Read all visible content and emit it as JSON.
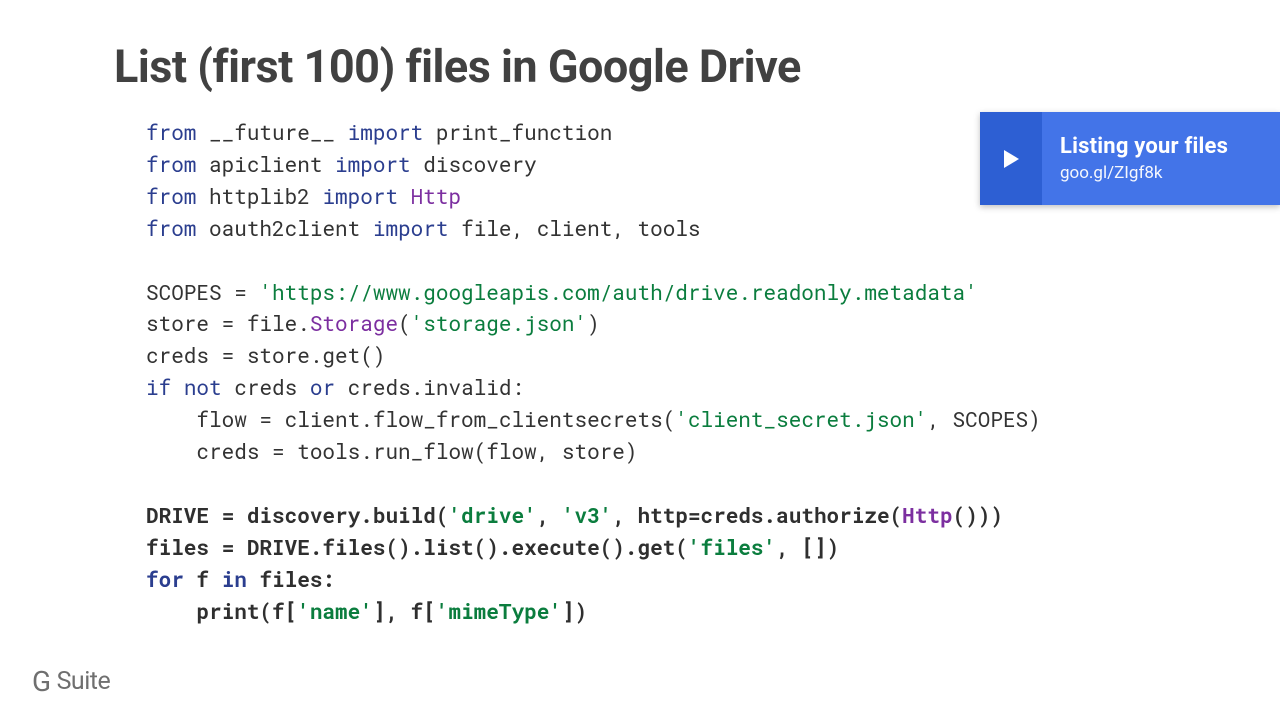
{
  "slide": {
    "title": "List (first 100) files in Google Drive"
  },
  "callout": {
    "title": "Listing your files",
    "link": "goo.gl/ZIgf8k"
  },
  "logo": {
    "g": "G",
    "suite": "Suite"
  },
  "code": {
    "l1": {
      "from": "from",
      "pkg": " __future__ ",
      "import": "import",
      "rest": " print_function"
    },
    "l2": {
      "from": "from",
      "pkg": " apiclient ",
      "import": "import",
      "rest": " discovery"
    },
    "l3": {
      "from": "from",
      "pkg": " httplib2 ",
      "import": "import",
      "cls": " Http"
    },
    "l4": {
      "from": "from",
      "pkg": " oauth2client ",
      "import": "import",
      "rest": " file, client, tools"
    },
    "l6": {
      "a": "SCOPES = ",
      "s": "'https://www.googleapis.com/auth/drive.readonly.metadata'"
    },
    "l7": {
      "a": "store = file.",
      "b": "Storage",
      "c": "(",
      "s": "'storage.json'",
      "d": ")"
    },
    "l8": {
      "a": "creds = store.get()"
    },
    "l9": {
      "if": "if",
      "sp1": " ",
      "not": "not",
      "mid": " creds ",
      "or": "or",
      "tail": " creds.invalid:"
    },
    "l10": {
      "a": "    flow = client.flow_from_clientsecrets(",
      "s": "'client_secret.json'",
      "b": ", SCOPES)"
    },
    "l11": {
      "a": "    creds = tools.run_flow(flow, store)"
    },
    "l13": {
      "a": "DRIVE = discovery.build(",
      "s1": "'drive'",
      "c1": ", ",
      "s2": "'v3'",
      "c2": ", http=creds.authorize(",
      "cls": "Http",
      "c3": "()))"
    },
    "l14": {
      "a": "files = DRIVE.files().list().execute().get(",
      "s": "'files'",
      "b": ", [])"
    },
    "l15": {
      "for": "for",
      "mid": " f ",
      "in": "in",
      "tail": " files:"
    },
    "l16": {
      "a": "    print(f[",
      "s1": "'name'",
      "b": "], f[",
      "s2": "'mimeType'",
      "c": "])"
    }
  }
}
